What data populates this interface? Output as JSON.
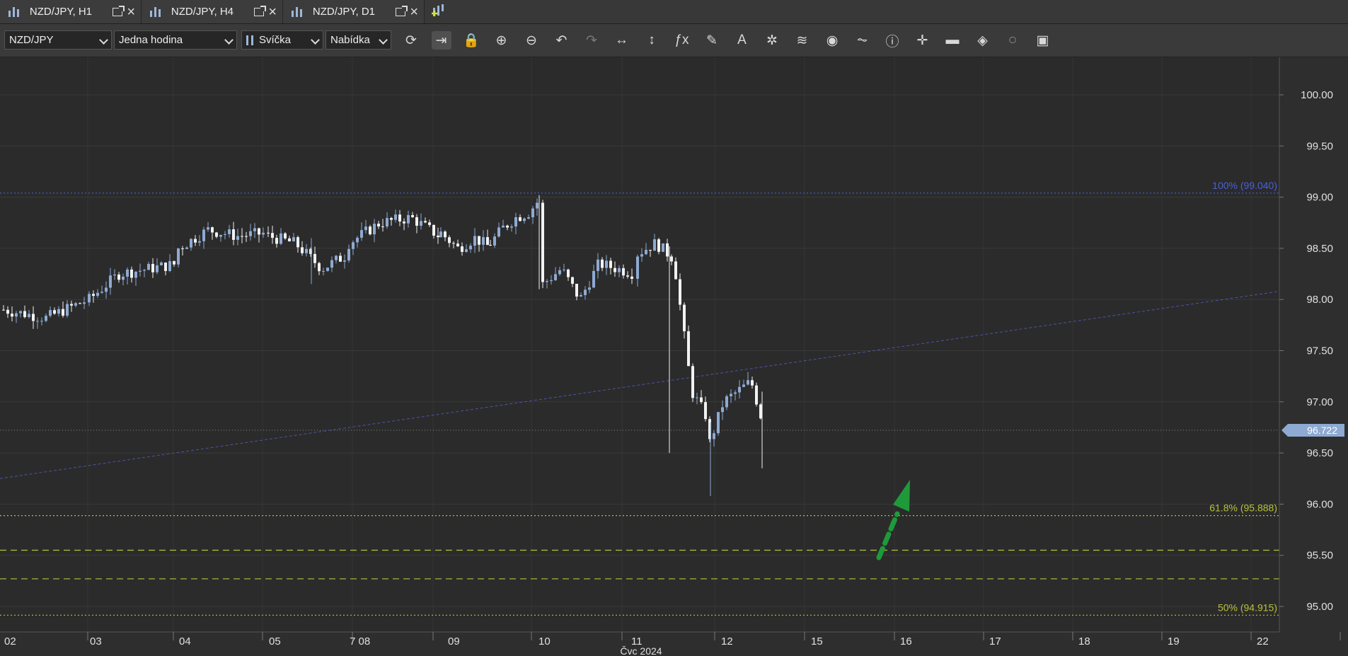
{
  "tabs": [
    {
      "label": "NZD/JPY, H1"
    },
    {
      "label": "NZD/JPY, H4"
    },
    {
      "label": "NZD/JPY, D1"
    }
  ],
  "toolbar": {
    "instrument": "NZD/JPY",
    "period": "Jedna hodina",
    "chart_type": "Svíčka",
    "price_type": "Nabídka",
    "icons": [
      "refresh-icon",
      "shift-chart-icon",
      "lock-icon",
      "zoom-in-icon",
      "zoom-out-icon",
      "undo-icon",
      "redo-icon",
      "horizontal-scale-icon",
      "vertical-scale-icon",
      "indicators-fx-icon",
      "draw-pencil-icon",
      "text-icon",
      "patterns-icon",
      "layers-icon",
      "eye-icon",
      "signals-icon",
      "info-icon",
      "crosshair-icon",
      "color-bar-icon",
      "paint-bucket-icon",
      "settings-cycle-icon",
      "save-icon"
    ]
  },
  "chart_data": {
    "type": "candlestick",
    "title": "",
    "xlabel": "Čvc 2024",
    "ylabel": "",
    "ylim": [
      94.75,
      100.5
    ],
    "y_ticks": [
      "100.00",
      "99.50",
      "99.00",
      "98.50",
      "98.00",
      "97.50",
      "97.00",
      "96.50",
      "96.00",
      "95.50",
      "95.00"
    ],
    "x_ticks": [
      "02",
      "03",
      "04",
      "05",
      "7 08",
      "09",
      "10",
      "11",
      "12",
      "15",
      "16",
      "17",
      "18",
      "19",
      "22"
    ],
    "month_label": "Čvc 2024",
    "current_price": "96.722",
    "colors": {
      "bull": "#8eaad2",
      "bear": "#f2f2f2",
      "fib_high": "#4a5fd8",
      "fib_levels": "#b6c23a",
      "arrow": "#1f9a3a",
      "trendline": "#4a55a8"
    },
    "fib_levels": [
      {
        "label": "100% (99.040)",
        "price": 99.04
      },
      {
        "label": "61.8% (95.888)",
        "price": 95.888
      },
      {
        "label": "",
        "price": 95.55
      },
      {
        "label": "",
        "price": 95.27
      },
      {
        "label": "50% (94.915)",
        "price": 94.915
      }
    ],
    "trendline": {
      "start": {
        "day": "02",
        "price": 96.25
      },
      "end": {
        "day": "22",
        "price": 98.08
      }
    },
    "daily_path": [
      {
        "day": "02",
        "prices": [
          97.9,
          97.82,
          98.0
        ]
      },
      {
        "day": "03",
        "prices": [
          98.0,
          98.25,
          98.3,
          98.35
        ]
      },
      {
        "day": "04",
        "prices": [
          98.5,
          98.68,
          98.62,
          98.65
        ]
      },
      {
        "day": "05",
        "prices": [
          98.62,
          98.55,
          98.3,
          98.45
        ]
      },
      {
        "day": "7 08",
        "prices": [
          98.55,
          98.75,
          98.8,
          98.6
        ]
      },
      {
        "day": "09",
        "prices": [
          98.65,
          98.5,
          98.6,
          98.5
        ]
      },
      {
        "day": "09b",
        "prices": [
          98.55,
          98.7,
          98.8,
          98.85,
          99.0
        ]
      },
      {
        "day": "10",
        "prices": [
          98.15,
          98.3,
          98.0,
          98.35,
          98.3,
          98.25
        ]
      },
      {
        "day": "11",
        "prices": [
          98.45,
          98.55,
          98.4,
          97.1,
          96.8
        ]
      },
      {
        "day": "12",
        "prices": [
          96.6,
          97.0,
          97.1,
          97.2,
          96.722
        ]
      }
    ]
  }
}
